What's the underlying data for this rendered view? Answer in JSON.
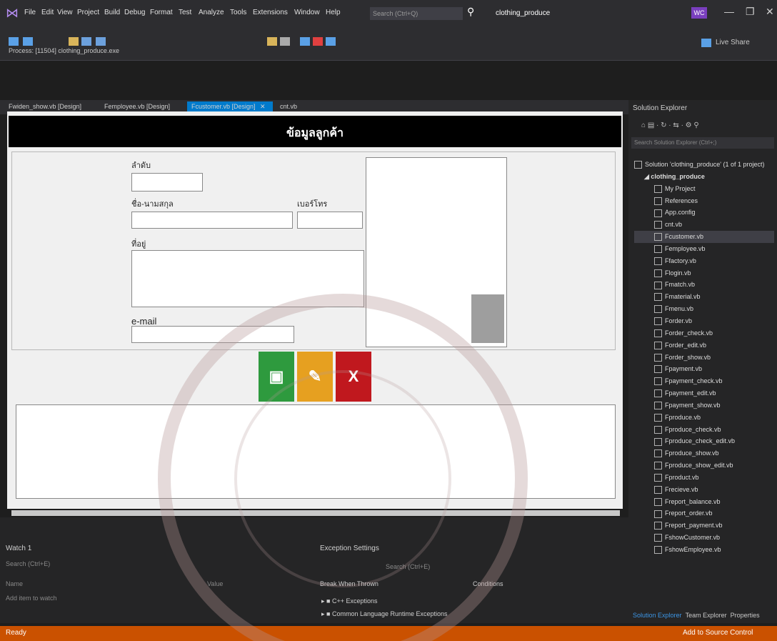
{
  "app": {
    "menus": [
      "File",
      "Edit",
      "View",
      "Project",
      "Build",
      "Debug",
      "Format",
      "Test",
      "Analyze",
      "Tools",
      "Extensions",
      "Window",
      "Help"
    ],
    "search_placeholder": "Search (Ctrl+Q)",
    "solution_name": "clothing_produce",
    "user_initials": "WC",
    "live_share": "Live Share",
    "process_label": "Process:",
    "process_value": "[11504] clothing_produce.exe"
  },
  "tabs": [
    {
      "label": "Fwiden_show.vb [Design]"
    },
    {
      "label": "Femployee.vb [Design]"
    },
    {
      "label": "Fcustomer.vb [Design]"
    },
    {
      "label": "cnt.vb"
    }
  ],
  "form": {
    "title": "ข้อมูลลูกค้า",
    "label_no": "ลำดับ",
    "label_name": "ชื่อ-นามสกุล",
    "label_phone": "เบอร์โทร",
    "label_address": "ที่อยู่",
    "label_email": "e-mail",
    "colors": {
      "save": "#2e9a3e",
      "edit": "#e6a020",
      "cancel": "#c0181e",
      "header": "#000000"
    }
  },
  "solution_explorer": {
    "title": "Solution Explorer",
    "search_placeholder": "Search Solution Explorer (Ctrl+;)",
    "solution_line": "Solution 'clothing_produce' (1 of 1 project)",
    "project": "clothing_produce",
    "items": [
      "My Project",
      "References",
      "App.config",
      "cnt.vb",
      "Fcustomer.vb",
      "Femployee.vb",
      "Ffactory.vb",
      "Flogin.vb",
      "Fmatch.vb",
      "Fmaterial.vb",
      "Fmenu.vb",
      "Forder.vb",
      "Forder_check.vb",
      "Forder_edit.vb",
      "Forder_show.vb",
      "Fpayment.vb",
      "Fpayment_check.vb",
      "Fpayment_edit.vb",
      "Fpayment_show.vb",
      "Fproduce.vb",
      "Fproduce_check.vb",
      "Fproduce_check_edit.vb",
      "Fproduce_show.vb",
      "Fproduce_show_edit.vb",
      "Fproduct.vb",
      "Frecieve.vb",
      "Freport_balance.vb",
      "Freport_order.vb",
      "Freport_payment.vb",
      "FshowCustomer.vb",
      "FshowEmployee.vb"
    ],
    "bottom_tabs": [
      "Solution Explorer",
      "Team Explorer",
      "Properties"
    ]
  },
  "watch": {
    "title": "Watch 1",
    "search": "Search (Ctrl+E)",
    "col_name": "Name",
    "col_value": "Value",
    "add_item": "Add item to watch"
  },
  "exceptions": {
    "title": "Exception Settings",
    "search": "Search (Ctrl+E)",
    "col_break": "Break When Thrown",
    "col_conditions": "Conditions",
    "rows": [
      "C++ Exceptions",
      "Common Language Runtime Exceptions"
    ]
  },
  "status": {
    "ready": "Ready",
    "source_control": "Add to Source Control"
  }
}
